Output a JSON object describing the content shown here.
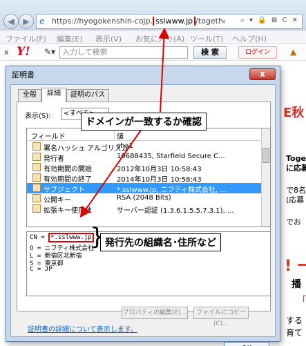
{
  "browser": {
    "url_prefix": "https://hyogokenshin-cojp.",
    "url_highlight": "sslwww.jp",
    "url_suffix": "/together/quiz.htm",
    "url_tools": "⌕ ▾ 🔒 ⊠ C ✕",
    "menu": [
      "ファイル(F)",
      "編集(E)",
      "表示(V)",
      "お気に入り(A)",
      "ツール(T)",
      "ヘルプ(H)"
    ],
    "toolbar": {
      "close": "x",
      "logo": "Y!",
      "search_placeholder": "入力して検索",
      "search_button": "検 索",
      "login_button": "ログイン"
    },
    "background_texts": [
      "E秋",
      "Toge",
      "に応募",
      "で8名",
      "(応募",
      "でお",
      "! ー",
      "播",
      "「",
      "する",
      "育て"
    ]
  },
  "dialog": {
    "title": "証明書",
    "close_label": "x",
    "tabs": [
      "全般",
      "詳細",
      "証明のパス"
    ],
    "show_label": "表示(S):",
    "show_value": "<すべて>",
    "columns": {
      "field": "フィールド",
      "value": "値"
    },
    "rows": [
      {
        "field": "署名ハッシュ アルゴリズム",
        "value": "sha1",
        "selected": false
      },
      {
        "field": "発行者",
        "value": "10688435, Starfield Secure C...",
        "selected": false
      },
      {
        "field": "有効期間の開始",
        "value": "2012年10月3日 10:58:43",
        "selected": false
      },
      {
        "field": "有効期間の終了",
        "value": "2014年10月3日 10:58:43",
        "selected": false
      },
      {
        "field": "サブジェクト",
        "value": "*.sslwww.jp, ニフティ株式会社, ...",
        "selected": true
      },
      {
        "field": "公開キー",
        "value": "RSA (2048 Bits)",
        "selected": false
      },
      {
        "field": "拡張キー使用法",
        "value": "サーバー認証 (1.3.6.1.5.5.7.3.1), ...",
        "selected": false
      }
    ],
    "detail": {
      "cn_key": "CN = ",
      "cn_value": "*.sslwww.jp",
      "lines": [
        "O = ニフティ株式会社",
        "L = 新宿区北新宿",
        "S = 東京都",
        "C = JP"
      ]
    },
    "props_button": "プロパティの編集(E)...",
    "copy_button": "ファイルにコピー(C)...",
    "detail_link": "証明書の詳細について表示します。",
    "ok_button": "OK"
  },
  "annotations": {
    "domain_check": "ドメインが一致するか確認",
    "org_info": "発行先の組織名･住所など",
    "brace": "}"
  },
  "colors": {
    "highlight": "#dd0000",
    "selection": "#3399ff",
    "link": "#0066cc"
  }
}
